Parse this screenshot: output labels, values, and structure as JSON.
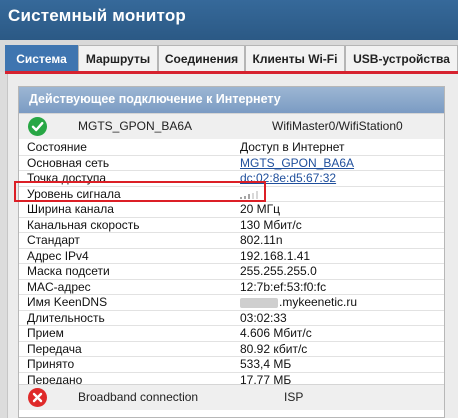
{
  "app": {
    "title": "Системный монитор"
  },
  "tabs": [
    {
      "label": "Система",
      "active": true
    },
    {
      "label": "Маршруты"
    },
    {
      "label": "Соединения"
    },
    {
      "label": "Клиенты Wi-Fi"
    },
    {
      "label": "USB-устройства"
    }
  ],
  "panel": {
    "header": "Действующее подключение к Интернету",
    "connection": {
      "name": "MGTS_GPON_BA6A",
      "interface": "WifiMaster0/WifiStation0",
      "status_icon": "check-icon"
    },
    "rows": [
      {
        "label": "Состояние",
        "value": "Доступ в Интернет"
      },
      {
        "label": "Основная сеть",
        "value": "MGTS_GPON_BA6A",
        "link": true
      },
      {
        "label": "Точка доступа",
        "value": "dc:02:8e:d5:67:32",
        "link": true
      },
      {
        "label": "Уровень сигнала",
        "value": "",
        "signal_bars": 5,
        "signal_level": 0.6
      },
      {
        "label": "Ширина канала",
        "value": "20 МГц"
      },
      {
        "label": "Канальная скорость",
        "value": "130 Мбит/с"
      },
      {
        "label": "Стандарт",
        "value": "802.11n"
      },
      {
        "label": "Адрес IPv4",
        "value": "192.168.1.41"
      },
      {
        "label": "Маска подсети",
        "value": "255.255.255.0"
      },
      {
        "label": "MAC-адрес",
        "value": "12:7b:ef:53:f0:fc"
      },
      {
        "label": "Имя KeenDNS",
        "value": ".mykeenetic.ru",
        "blurred_prefix": true
      },
      {
        "label": "Длительность",
        "value": "03:02:33"
      },
      {
        "label": "Прием",
        "value": "4.606 Мбит/с"
      },
      {
        "label": "Передача",
        "value": "80.92 кбит/с"
      },
      {
        "label": "Принято",
        "value": "533,4 МБ"
      },
      {
        "label": "Передано",
        "value": "17,77 МБ"
      }
    ],
    "secondary": {
      "name": "Broadband connection",
      "interface": "ISP",
      "status_icon": "error-icon"
    }
  },
  "colors": {
    "topbar": "#2e5e8e",
    "active_tab": "#3f75b0",
    "accent_red": "#d6222f",
    "ok": "#28a745",
    "error": "#df2a2a"
  }
}
